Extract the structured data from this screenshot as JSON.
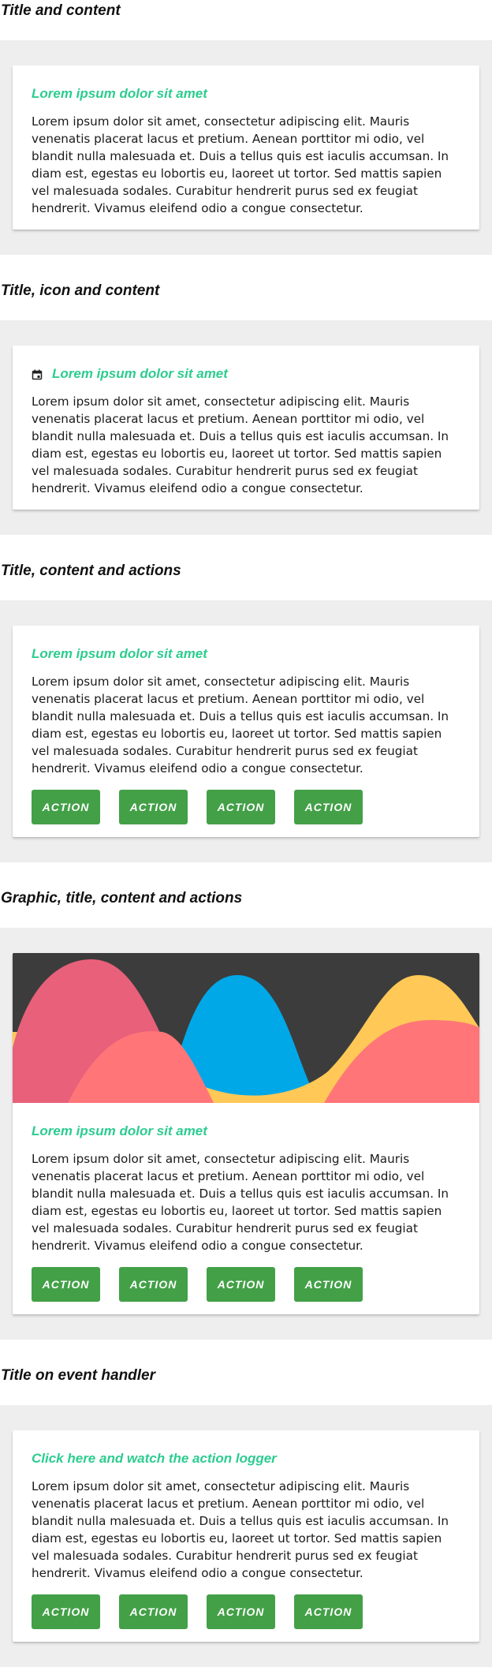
{
  "lorem": "Lorem ipsum dolor sit amet, consectetur adipiscing elit. Mauris venenatis placerat lacus et pretium. Aenean porttitor mi odio, vel blandit nulla malesuada et. Duis a tellus quis est iaculis accumsan. In diam est, egestas eu lobortis eu, laoreet ut tortor. Sed mattis sapien vel malesuada sodales. Curabitur hendrerit purus sed ex feugiat hendrerit. Vivamus eleifend odio a congue consectetur.",
  "sections": [
    {
      "heading": "Title and content",
      "card_title": "Lorem ipsum dolor sit amet"
    },
    {
      "heading": "Title, icon and content",
      "card_title": "Lorem ipsum dolor sit amet",
      "icon": "calendar-icon"
    },
    {
      "heading": "Title, content and actions",
      "card_title": "Lorem ipsum dolor sit amet",
      "actions": [
        "ACTION",
        "ACTION",
        "ACTION",
        "ACTION"
      ]
    },
    {
      "heading": "Graphic, title, content and actions",
      "card_title": "Lorem ipsum dolor sit amet",
      "actions": [
        "ACTION",
        "ACTION",
        "ACTION",
        "ACTION"
      ],
      "graphic": "wave-graphic"
    },
    {
      "heading": "Title on event handler",
      "card_title": "Click here and watch the action logger",
      "actions": [
        "ACTION",
        "ACTION",
        "ACTION",
        "ACTION"
      ]
    }
  ],
  "colors": {
    "title": "#2dcc8f",
    "button": "#43a047",
    "band": "#eeeeee",
    "graphic_bg": "#3c3c3c",
    "wave_pink": "#e8607a",
    "wave_salmon": "#ff7578",
    "wave_yellow": "#ffc857",
    "wave_blue": "#00a8e8"
  }
}
